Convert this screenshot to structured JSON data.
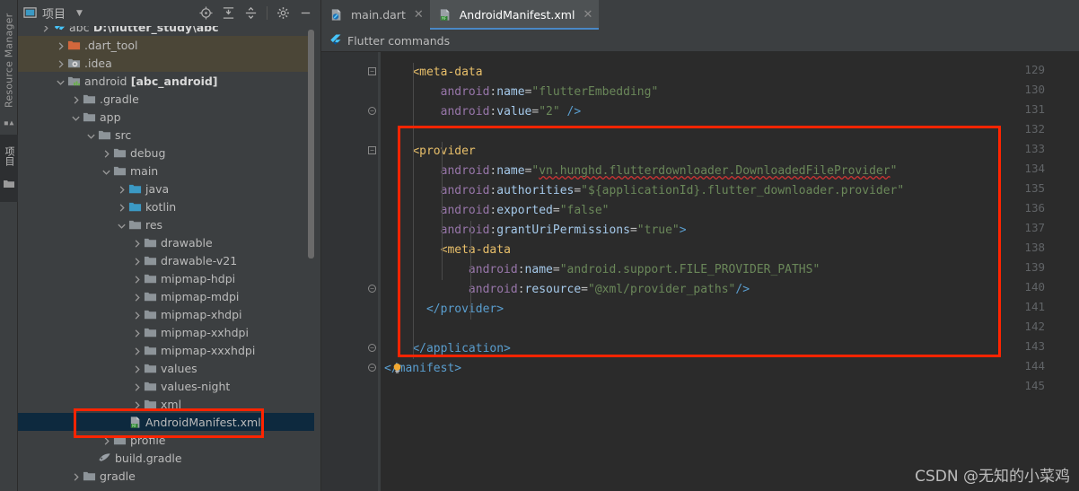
{
  "left_strip": {
    "resource_manager_label": "Resource Manager",
    "project_tab_label": "项目"
  },
  "project_panel": {
    "title": "项目",
    "title_icon": "project-panel-icon",
    "caret_icon": "chevron-down-icon",
    "tools": [
      {
        "name": "locate-in-tree-icon",
        "label": "Select Opened File"
      },
      {
        "name": "expand-all-icon",
        "label": "Expand All"
      },
      {
        "name": "collapse-all-icon",
        "label": "Collapse All"
      },
      {
        "name": "gear-icon",
        "label": "Settings"
      },
      {
        "name": "minimize-icon",
        "label": "Hide"
      }
    ],
    "tree": [
      {
        "indent": 1,
        "arrow": "collapsed",
        "icon": "flutter-project-icon",
        "label": "abc",
        "suffix": " D:\\flutter_study\\abc",
        "state": "cut",
        "highlight": false
      },
      {
        "indent": 2,
        "arrow": "collapsed",
        "icon": "folder-orange-icon",
        "label": ".dart_tool",
        "suffix": "",
        "state": "normal",
        "highlight": true
      },
      {
        "indent": 2,
        "arrow": "collapsed",
        "icon": "idea-folder-icon",
        "label": ".idea",
        "suffix": "",
        "state": "normal",
        "highlight": true
      },
      {
        "indent": 2,
        "arrow": "expanded",
        "icon": "module-folder-icon",
        "label": "android",
        "suffix": " [abc_android]",
        "state": "module",
        "highlight": false
      },
      {
        "indent": 3,
        "arrow": "collapsed",
        "icon": "folder-icon",
        "label": ".gradle",
        "suffix": "",
        "state": "normal",
        "highlight": false
      },
      {
        "indent": 3,
        "arrow": "expanded",
        "icon": "folder-icon",
        "label": "app",
        "suffix": "",
        "state": "normal",
        "highlight": false
      },
      {
        "indent": 4,
        "arrow": "expanded",
        "icon": "folder-icon",
        "label": "src",
        "suffix": "",
        "state": "normal",
        "highlight": false
      },
      {
        "indent": 5,
        "arrow": "collapsed",
        "icon": "folder-icon",
        "label": "debug",
        "suffix": "",
        "state": "normal",
        "highlight": false
      },
      {
        "indent": 5,
        "arrow": "expanded",
        "icon": "folder-icon",
        "label": "main",
        "suffix": "",
        "state": "normal",
        "highlight": false
      },
      {
        "indent": 6,
        "arrow": "collapsed",
        "icon": "source-folder-icon",
        "label": "java",
        "suffix": "",
        "state": "normal",
        "highlight": false
      },
      {
        "indent": 6,
        "arrow": "collapsed",
        "icon": "source-folder-icon",
        "label": "kotlin",
        "suffix": "",
        "state": "normal",
        "highlight": false
      },
      {
        "indent": 6,
        "arrow": "expanded",
        "icon": "folder-icon",
        "label": "res",
        "suffix": "",
        "state": "normal",
        "highlight": false
      },
      {
        "indent": 7,
        "arrow": "collapsed",
        "icon": "folder-icon",
        "label": "drawable",
        "suffix": "",
        "state": "normal",
        "highlight": false
      },
      {
        "indent": 7,
        "arrow": "collapsed",
        "icon": "folder-icon",
        "label": "drawable-v21",
        "suffix": "",
        "state": "normal",
        "highlight": false
      },
      {
        "indent": 7,
        "arrow": "collapsed",
        "icon": "folder-icon",
        "label": "mipmap-hdpi",
        "suffix": "",
        "state": "normal",
        "highlight": false
      },
      {
        "indent": 7,
        "arrow": "collapsed",
        "icon": "folder-icon",
        "label": "mipmap-mdpi",
        "suffix": "",
        "state": "normal",
        "highlight": false
      },
      {
        "indent": 7,
        "arrow": "collapsed",
        "icon": "folder-icon",
        "label": "mipmap-xhdpi",
        "suffix": "",
        "state": "normal",
        "highlight": false
      },
      {
        "indent": 7,
        "arrow": "collapsed",
        "icon": "folder-icon",
        "label": "mipmap-xxhdpi",
        "suffix": "",
        "state": "normal",
        "highlight": false
      },
      {
        "indent": 7,
        "arrow": "collapsed",
        "icon": "folder-icon",
        "label": "mipmap-xxxhdpi",
        "suffix": "",
        "state": "normal",
        "highlight": false
      },
      {
        "indent": 7,
        "arrow": "collapsed",
        "icon": "folder-icon",
        "label": "values",
        "suffix": "",
        "state": "normal",
        "highlight": false
      },
      {
        "indent": 7,
        "arrow": "collapsed",
        "icon": "folder-icon",
        "label": "values-night",
        "suffix": "",
        "state": "normal",
        "highlight": false
      },
      {
        "indent": 7,
        "arrow": "collapsed",
        "icon": "folder-icon",
        "label": "xml",
        "suffix": "",
        "state": "normal",
        "highlight": false
      },
      {
        "indent": 6,
        "arrow": "none",
        "icon": "manifest-file-icon",
        "label": "AndroidManifest.xml",
        "suffix": "",
        "state": "selected",
        "highlight": false
      },
      {
        "indent": 5,
        "arrow": "collapsed",
        "icon": "folder-icon",
        "label": "profile",
        "suffix": "",
        "state": "normal",
        "highlight": false
      },
      {
        "indent": 4,
        "arrow": "none",
        "icon": "gradle-file-icon",
        "label": "build.gradle",
        "suffix": "",
        "state": "normal",
        "highlight": false
      },
      {
        "indent": 3,
        "arrow": "collapsed",
        "icon": "folder-icon",
        "label": "gradle",
        "suffix": "",
        "state": "normal",
        "highlight": false
      }
    ],
    "scrollbar": "vertical-scrollbar"
  },
  "editor": {
    "tabs": [
      {
        "label": "main.dart",
        "icon": "dart-file-icon",
        "active": false,
        "close_icon": "close-icon"
      },
      {
        "label": "AndroidManifest.xml",
        "icon": "manifest-file-icon",
        "active": true,
        "close_icon": "close-icon"
      }
    ],
    "command_bar": {
      "icon": "flutter-icon",
      "label": "Flutter commands"
    },
    "lightbulb_icon": "intention-bulb-icon",
    "first_line_number": 129,
    "lines": [
      {
        "num": 129,
        "fold": "minus",
        "indent": 4,
        "tokens": [
          {
            "t": "<meta-data",
            "c": "t-tag"
          }
        ]
      },
      {
        "num": 130,
        "fold": "",
        "indent": 8,
        "tokens": [
          {
            "t": "android",
            "c": "t-ns"
          },
          {
            "t": ":",
            "c": "t-eq"
          },
          {
            "t": "name",
            "c": "t-attr"
          },
          {
            "t": "=",
            "c": "t-eq"
          },
          {
            "t": "\"flutterEmbedding\"",
            "c": "t-str"
          }
        ]
      },
      {
        "num": 131,
        "fold": "round",
        "indent": 8,
        "tokens": [
          {
            "t": "android",
            "c": "t-ns"
          },
          {
            "t": ":",
            "c": "t-eq"
          },
          {
            "t": "value",
            "c": "t-attr"
          },
          {
            "t": "=",
            "c": "t-eq"
          },
          {
            "t": "\"2\" ",
            "c": "t-str"
          },
          {
            "t": "/>",
            "c": "t-brak"
          }
        ]
      },
      {
        "num": 132,
        "fold": "",
        "indent": 0,
        "tokens": []
      },
      {
        "num": 133,
        "fold": "minus",
        "indent": 4,
        "tokens": [
          {
            "t": "<provider",
            "c": "t-tag"
          }
        ]
      },
      {
        "num": 134,
        "fold": "",
        "indent": 8,
        "tokens": [
          {
            "t": "android",
            "c": "t-ns"
          },
          {
            "t": ":",
            "c": "t-eq"
          },
          {
            "t": "name",
            "c": "t-attr"
          },
          {
            "t": "=",
            "c": "t-eq"
          },
          {
            "t": "\"",
            "c": "t-str"
          },
          {
            "t": "vn.hunghd.flutterdownloader.DownloadedFileProvider",
            "c": "t-err"
          },
          {
            "t": "\"",
            "c": "t-str"
          }
        ]
      },
      {
        "num": 135,
        "fold": "",
        "indent": 8,
        "tokens": [
          {
            "t": "android",
            "c": "t-ns"
          },
          {
            "t": ":",
            "c": "t-eq"
          },
          {
            "t": "authorities",
            "c": "t-attr"
          },
          {
            "t": "=",
            "c": "t-eq"
          },
          {
            "t": "\"${applicationId}.flutter_downloader.provider\"",
            "c": "t-str"
          }
        ]
      },
      {
        "num": 136,
        "fold": "",
        "indent": 8,
        "tokens": [
          {
            "t": "android",
            "c": "t-ns"
          },
          {
            "t": ":",
            "c": "t-eq"
          },
          {
            "t": "exported",
            "c": "t-attr"
          },
          {
            "t": "=",
            "c": "t-eq"
          },
          {
            "t": "\"false\"",
            "c": "t-str"
          }
        ]
      },
      {
        "num": 137,
        "fold": "",
        "indent": 8,
        "tokens": [
          {
            "t": "android",
            "c": "t-ns"
          },
          {
            "t": ":",
            "c": "t-eq"
          },
          {
            "t": "grantUriPermissions",
            "c": "t-attr"
          },
          {
            "t": "=",
            "c": "t-eq"
          },
          {
            "t": "\"true\"",
            "c": "t-str"
          },
          {
            "t": ">",
            "c": "t-brak"
          }
        ]
      },
      {
        "num": 138,
        "fold": "",
        "indent": 8,
        "tokens": [
          {
            "t": "<meta-data",
            "c": "t-tag"
          }
        ]
      },
      {
        "num": 139,
        "fold": "",
        "indent": 12,
        "tokens": [
          {
            "t": "android",
            "c": "t-ns"
          },
          {
            "t": ":",
            "c": "t-eq"
          },
          {
            "t": "name",
            "c": "t-attr"
          },
          {
            "t": "=",
            "c": "t-eq"
          },
          {
            "t": "\"android.support.FILE_PROVIDER_PATHS\"",
            "c": "t-str"
          }
        ]
      },
      {
        "num": 140,
        "fold": "round",
        "indent": 12,
        "tokens": [
          {
            "t": "android",
            "c": "t-ns"
          },
          {
            "t": ":",
            "c": "t-eq"
          },
          {
            "t": "resource",
            "c": "t-attr"
          },
          {
            "t": "=",
            "c": "t-eq"
          },
          {
            "t": "\"@xml/provider_paths\"",
            "c": "t-str"
          },
          {
            "t": "/>",
            "c": "t-brak"
          }
        ]
      },
      {
        "num": 141,
        "fold": "",
        "indent": 6,
        "tokens": [
          {
            "t": "</provider>",
            "c": "t-brak"
          }
        ]
      },
      {
        "num": 142,
        "fold": "",
        "indent": 0,
        "tokens": []
      },
      {
        "num": 143,
        "fold": "round",
        "indent": 4,
        "tokens": [
          {
            "t": "</application>",
            "c": "t-brak"
          }
        ]
      },
      {
        "num": 144,
        "fold": "round",
        "indent": 0,
        "tokens": [
          {
            "t": "</manifest>",
            "c": "t-brak"
          }
        ]
      },
      {
        "num": 145,
        "fold": "",
        "indent": 0,
        "tokens": []
      }
    ]
  },
  "annotations": [
    {
      "name": "red-box-tree-highlight",
      "target": "AndroidManifest.xml tree item"
    },
    {
      "name": "red-box-code-highlight",
      "target": "provider block lines 132-143"
    }
  ],
  "watermark": "CSDN @无知的小菜鸡",
  "colors": {
    "accent": "#4a88c7",
    "annotation": "#ff2400",
    "selection": "#0d293e",
    "editor_bg": "#2b2b2b",
    "panel_bg": "#3c3f41",
    "string": "#6a8759",
    "tag": "#e8bf6a",
    "namespace": "#9876aa",
    "attribute": "#a5c9ea"
  }
}
